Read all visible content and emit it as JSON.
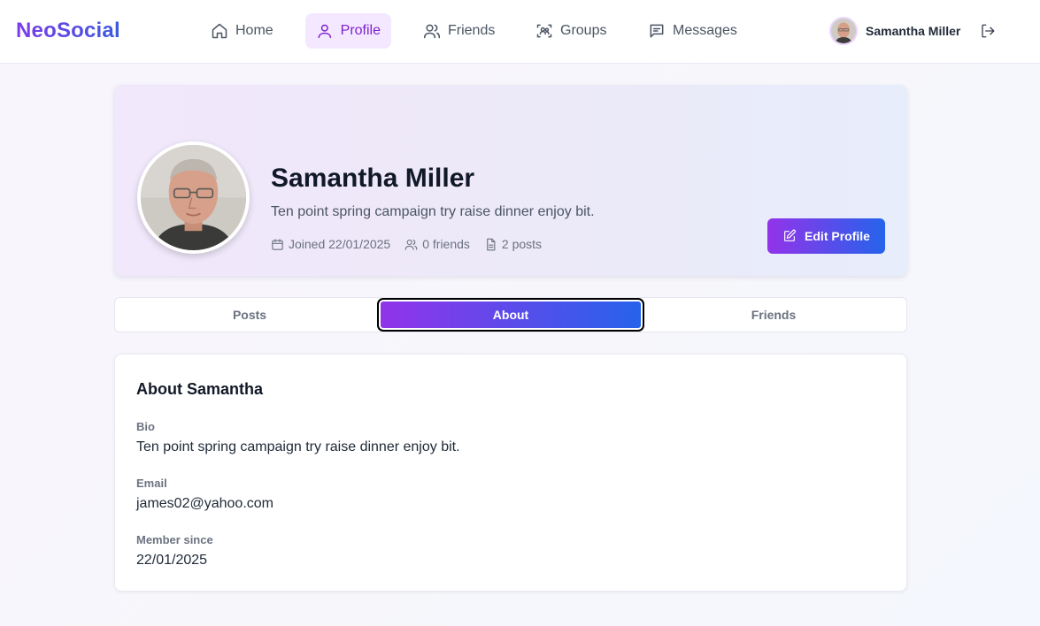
{
  "app": {
    "brand": "NeoSocial"
  },
  "nav": {
    "items": [
      {
        "label": "Home",
        "icon": "home-icon"
      },
      {
        "label": "Profile",
        "icon": "user-icon",
        "active": true
      },
      {
        "label": "Friends",
        "icon": "users-icon"
      },
      {
        "label": "Groups",
        "icon": "group-scan-icon"
      },
      {
        "label": "Messages",
        "icon": "message-square-icon"
      }
    ],
    "user_name": "Samantha Miller"
  },
  "profile": {
    "name": "Samantha Miller",
    "bio": "Ten point spring campaign try raise dinner enjoy bit.",
    "joined": "Joined 22/01/2025",
    "friends_count": "0 friends",
    "posts_count": "2 posts",
    "edit_label": "Edit Profile"
  },
  "tabs": [
    {
      "label": "Posts"
    },
    {
      "label": "About",
      "active": true
    },
    {
      "label": "Friends"
    }
  ],
  "about": {
    "title": "About Samantha",
    "bio_label": "Bio",
    "bio_value": "Ten point spring campaign try raise dinner enjoy bit.",
    "email_label": "Email",
    "email_value": "james02@yahoo.com",
    "member_label": "Member since",
    "member_value": "22/01/2025"
  },
  "colors": {
    "accent_purple": "#9333ea",
    "accent_blue": "#2563eb",
    "active_nav_bg": "#f3e8ff",
    "active_nav_text": "#7e22ce"
  }
}
